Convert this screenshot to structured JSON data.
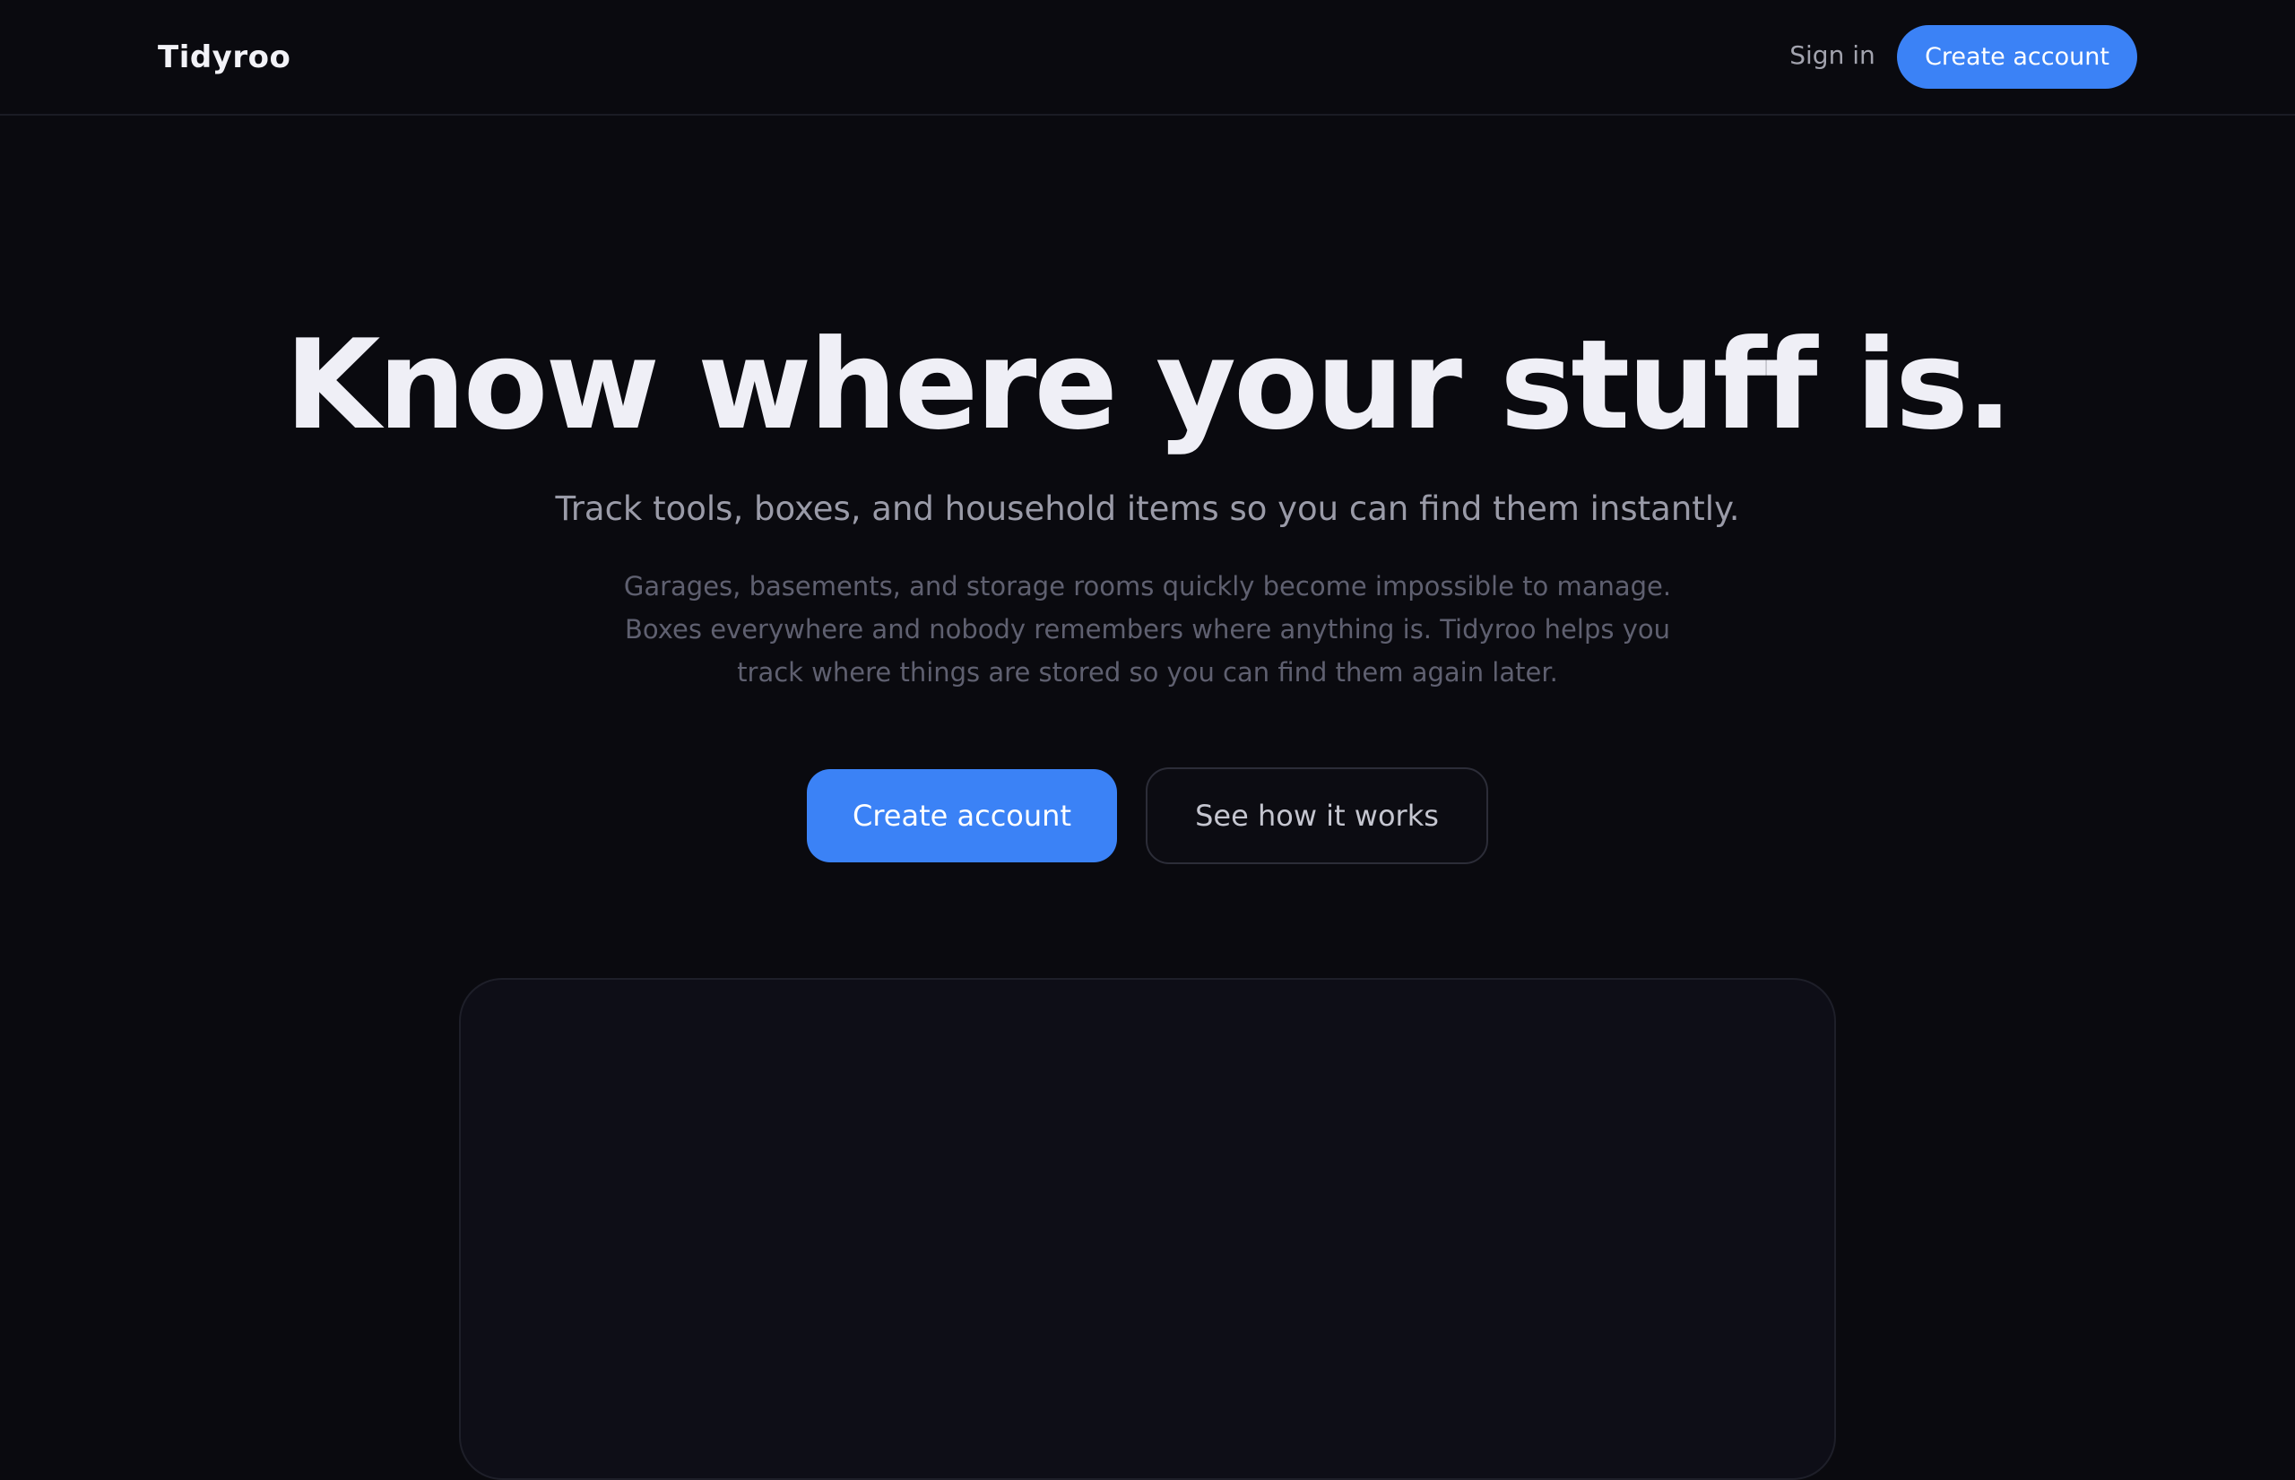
{
  "nav": {
    "logo": "Tidyroo",
    "sign_in": "Sign in",
    "create_account": "Create account"
  },
  "hero": {
    "title": "Know where your stuff is.",
    "subtitle": "Track tools, boxes, and household items so you can find them instantly.",
    "body": "Garages, basements, and storage rooms quickly become impossible to manage. Boxes everywhere and nobody remembers where anything is. Tidyroo helps you track where things are stored so you can find them again later.",
    "primary_cta": "Create account",
    "secondary_cta": "See how it works"
  },
  "colors": {
    "background": "#0a0a0f",
    "accent": "#3b82f6",
    "panel": "#0e0e17"
  }
}
